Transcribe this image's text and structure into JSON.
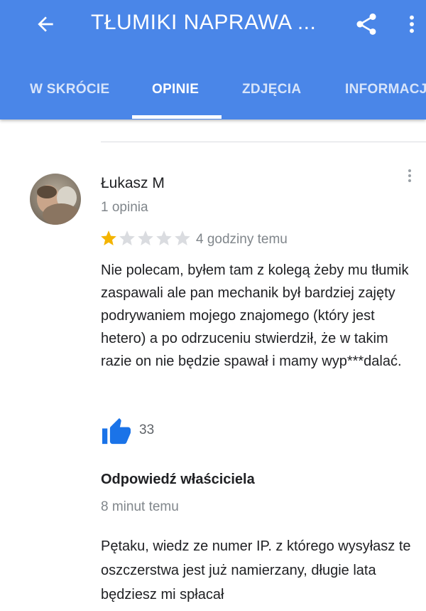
{
  "toolbar": {
    "title": "TŁUMIKI NAPRAWA ...",
    "back_icon": "arrow-back-icon",
    "share_icon": "share-icon",
    "more_icon": "more-vert-icon"
  },
  "tabs": [
    {
      "label": "W SKRÓCIE",
      "active": false
    },
    {
      "label": "OPINIE",
      "active": true
    },
    {
      "label": "ZDJĘCIA",
      "active": false
    },
    {
      "label": "INFORMACJE",
      "active": false
    }
  ],
  "review": {
    "author": "Łukasz M",
    "author_reviews": "1 opinia",
    "rating": 1,
    "rating_max": 5,
    "time": "4 godziny temu",
    "text": "Nie polecam, byłem tam z kolegą żeby mu tłumik zaspawali ale pan mechanik był bardziej zajęty podrywaniem mojego znajomego (który jest hetero) a po odrzuceniu stwierdził, że w takim razie on nie będzie spawał i mamy wyp***dalać.",
    "likes": "33"
  },
  "owner_response": {
    "heading": "Odpowiedź właściciela",
    "time": "8 minut temu",
    "text": "Pętaku, wiedz ze numer IP. z którego wysyłasz te oszczerstwa jest już namierzany, długie lata będziesz mi spłacał"
  },
  "colors": {
    "appbar": "#4a86e8",
    "star_filled": "#f4b400",
    "star_empty": "#dadce0",
    "like": "#1a73e8"
  }
}
